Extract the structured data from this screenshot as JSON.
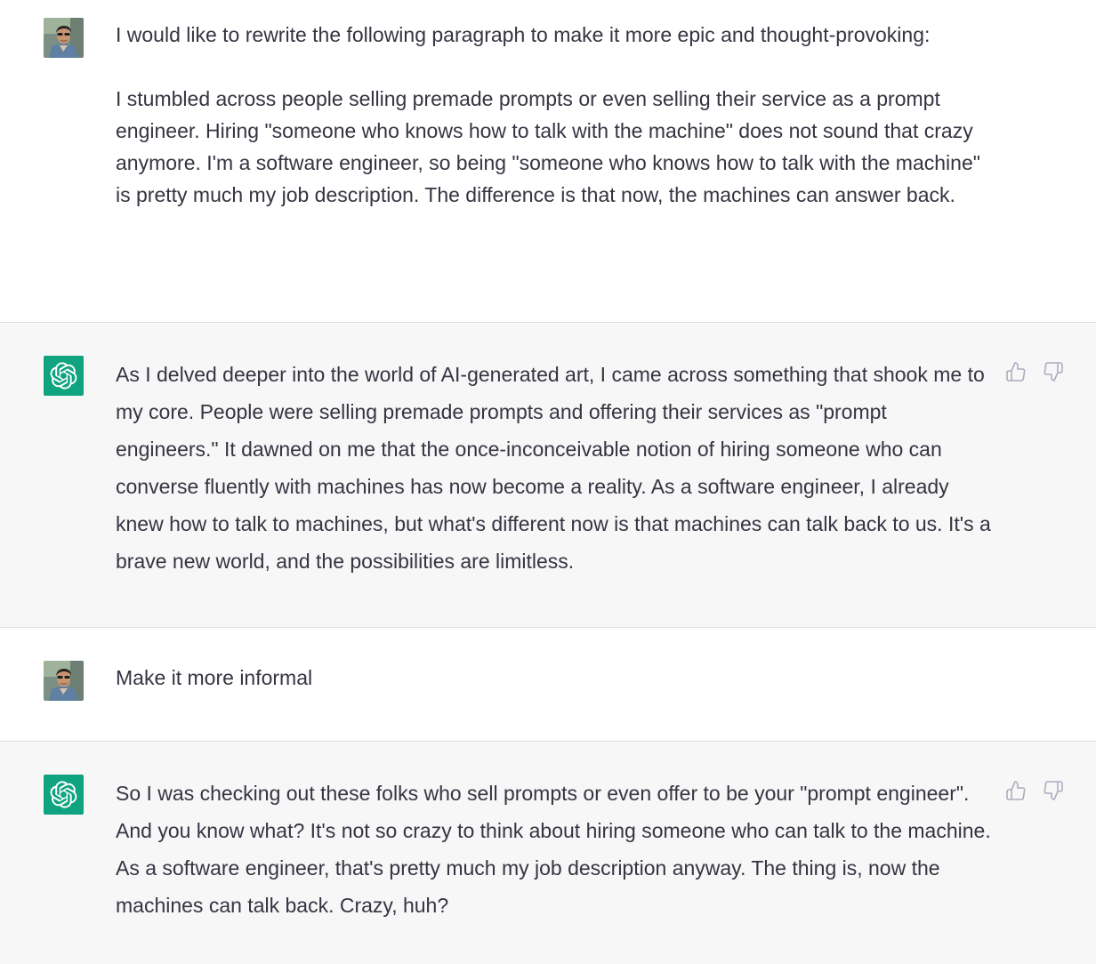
{
  "messages": [
    {
      "role": "user",
      "avatar_icon": "user-avatar-photo",
      "paragraphs": [
        "I would like to rewrite the following paragraph to make it more epic and thought-provoking:",
        "I stumbled across people selling premade prompts or even selling their service as a prompt engineer. Hiring \"someone who knows how to talk with the machine\" does not sound that crazy anymore. I'm a software engineer, so being \"someone who knows how to talk with the machine\" is pretty much my job description. The difference is that now, the machines can answer back."
      ]
    },
    {
      "role": "assistant",
      "avatar_icon": "openai-logo-icon",
      "paragraphs": [
        "As I delved deeper into the world of AI-generated art, I came across something that shook me to my core. People were selling premade prompts and offering their services as \"prompt engineers.\" It dawned on me that the once-inconceivable notion of hiring someone who can converse fluently with machines has now become a reality. As a software engineer, I already knew how to talk to machines, but what's different now is that machines can talk back to us. It's a brave new world, and the possibilities are limitless."
      ],
      "feedback": [
        "thumbs-up-icon",
        "thumbs-down-icon"
      ]
    },
    {
      "role": "user",
      "avatar_icon": "user-avatar-photo",
      "paragraphs": [
        "Make it more informal"
      ]
    },
    {
      "role": "assistant",
      "avatar_icon": "openai-logo-icon",
      "paragraphs": [
        "So I was checking out these folks who sell prompts or even offer to be your \"prompt engineer\". And you know what? It's not so crazy to think about hiring someone who can talk to the machine. As a software engineer, that's pretty much my job description anyway. The thing is, now the machines can talk back. Crazy, huh?"
      ],
      "feedback": [
        "thumbs-up-icon",
        "thumbs-down-icon"
      ]
    }
  ],
  "colors": {
    "assistant_bg": "#f7f7f8",
    "user_bg": "#ffffff",
    "brand_green": "#10a37f",
    "text": "#343541",
    "icon_gray": "#acacbe",
    "divider": "#dfdfe3"
  }
}
